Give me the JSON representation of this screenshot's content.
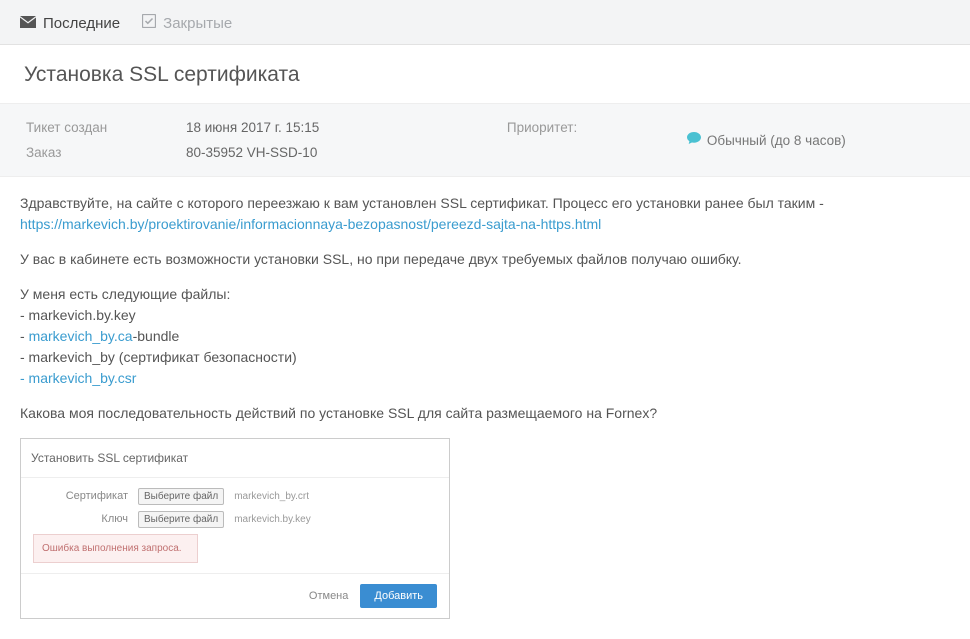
{
  "tabs": {
    "recent": "Последние",
    "closed": "Закрытые"
  },
  "ticket": {
    "title": "Установка SSL сертификата",
    "created_label": "Тикет создан",
    "created_value": "18 июня 2017 г. 15:15",
    "order_label": "Заказ",
    "order_value": "80-35952 VH-SSD-10",
    "priority_label": "Приоритет:",
    "priority_value": "Обычный (до 8 часов)"
  },
  "message": {
    "intro": "Здравствуйте, на сайте с которого переезжаю к вам установлен SSL сертификат. Процесс его установки ранее был таким -",
    "link": "https://markevich.by/proektirovanie/informacionnaya-bezopasnost/pereezd-sajta-na-https.html",
    "para2": "У вас в кабинете есть возможности установки SSL, но при передаче двух требуемых файлов получаю ошибку.",
    "files_intro": "У меня есть следующие файлы",
    "colon": ":",
    "file1": "- markevich.by.key",
    "file2_pre": "- ",
    "file2_link": "markevich_by.ca",
    "file2_suf": "-bundle",
    "file3": "- markevich_by (сертификат безопасности)",
    "file4": "- markevich_by.csr",
    "question": "Какова моя последовательность действий по установке SSL для сайта размещаемого на Fornex?"
  },
  "embedded": {
    "title": "Установить SSL сертификат",
    "cert_label": "Сертификат",
    "key_label": "Ключ",
    "choose_btn": "Выберите файл",
    "cert_file": "markevich_by.crt",
    "key_file": "markevich.by.key",
    "error": "Ошибка выполнения запроса.",
    "cancel": "Отмена",
    "add": "Добавить"
  }
}
